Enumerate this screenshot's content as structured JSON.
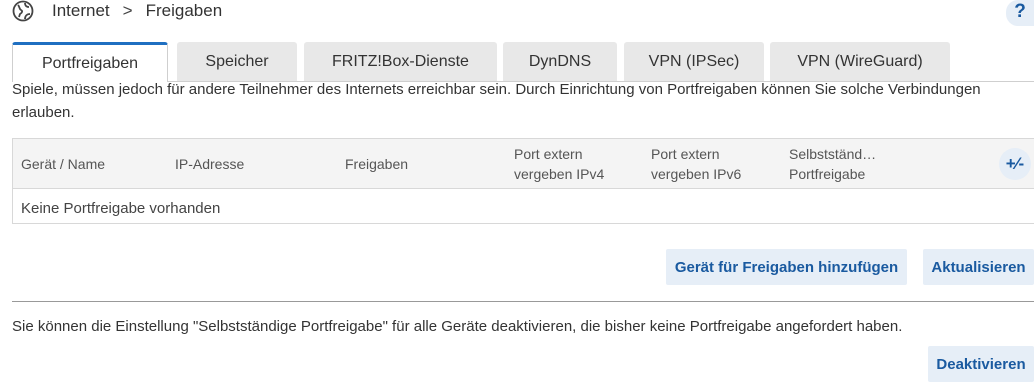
{
  "breadcrumb": {
    "root_icon": "globe-icon",
    "items": [
      "Internet",
      "Freigaben"
    ],
    "separator": ">"
  },
  "help": {
    "label": "?"
  },
  "tabs": [
    {
      "label": "Portfreigaben",
      "active": true
    },
    {
      "label": "Speicher",
      "active": false
    },
    {
      "label": "FRITZ!Box-Dienste",
      "active": false
    },
    {
      "label": "DynDNS",
      "active": false
    },
    {
      "label": "VPN (IPSec)",
      "active": false
    },
    {
      "label": "VPN (WireGuard)",
      "active": false
    }
  ],
  "intro_text": "Spiele, müssen jedoch für andere Teilnehmer des Internets erreichbar sein. Durch Einrichtung von Portfreigaben können Sie solche Verbindungen erlauben.",
  "table": {
    "columns": [
      {
        "line1": "Gerät / Name",
        "line2": ""
      },
      {
        "line1": "IP-Adresse",
        "line2": ""
      },
      {
        "line1": "Freigaben",
        "line2": ""
      },
      {
        "line1": "Port extern",
        "line2": "vergeben IPv4"
      },
      {
        "line1": "Port extern",
        "line2": "vergeben IPv6"
      },
      {
        "line1": "Selbstständ…",
        "line2": "Portfreigabe"
      }
    ],
    "toggle_icon": "plus-minus-icon",
    "toggle_label": "+⁄-",
    "empty_text": "Keine Portfreigabe vorhanden"
  },
  "buttons": {
    "add_device": "Gerät für Freigaben hinzufügen",
    "refresh": "Aktualisieren",
    "deactivate": "Deaktivieren"
  },
  "note_text": "Sie können die Einstellung \"Selbstständige Portfreigabe\" für alle Geräte deaktivieren, die bisher keine Portfreigabe angefordert haben.",
  "colors": {
    "accent": "#1f6fc1",
    "button_bg": "#e6eef7",
    "button_text": "#1a5aa0"
  }
}
